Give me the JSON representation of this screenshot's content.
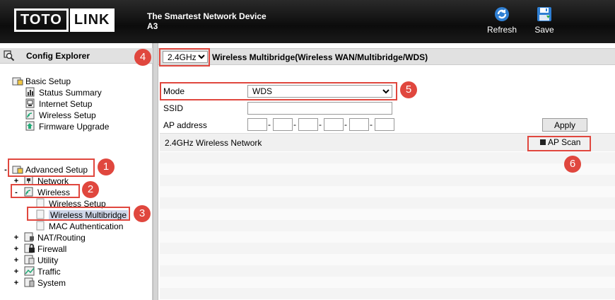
{
  "header": {
    "logo_left": "TOTO",
    "logo_right": "LINK",
    "tagline": "The Smartest Network Device",
    "model": "A3",
    "refresh_label": "Refresh",
    "save_label": "Save"
  },
  "explorer": {
    "title": "Config Explorer",
    "basic_setup": {
      "label": "Basic Setup",
      "items": [
        "Status Summary",
        "Internet Setup",
        "Wireless Setup",
        "Firmware Upgrade"
      ]
    },
    "advanced_setup": {
      "label": "Advanced Setup",
      "network": "Network",
      "wireless": "Wireless",
      "wireless_items": [
        "Wireless Setup",
        "Wireless Multibridge",
        "MAC Authentication"
      ],
      "others": [
        "NAT/Routing",
        "Firewall",
        "Utility",
        "Traffic",
        "System"
      ]
    }
  },
  "main": {
    "band": "2.4GHz",
    "title": "Wireless Multibridge(Wireless WAN/Multibridge/WDS)",
    "mode_label": "Mode",
    "mode_value": "WDS",
    "ssid_label": "SSID",
    "ap_label": "AP address",
    "apply_label": "Apply",
    "network_label": "2.4GHz Wireless Network",
    "scan_label": "AP Scan"
  },
  "callouts": [
    "1",
    "2",
    "3",
    "4",
    "5",
    "6"
  ],
  "colors": {
    "callout": "#e0473e",
    "header": "#111111",
    "selected": "#cfd6e8"
  }
}
